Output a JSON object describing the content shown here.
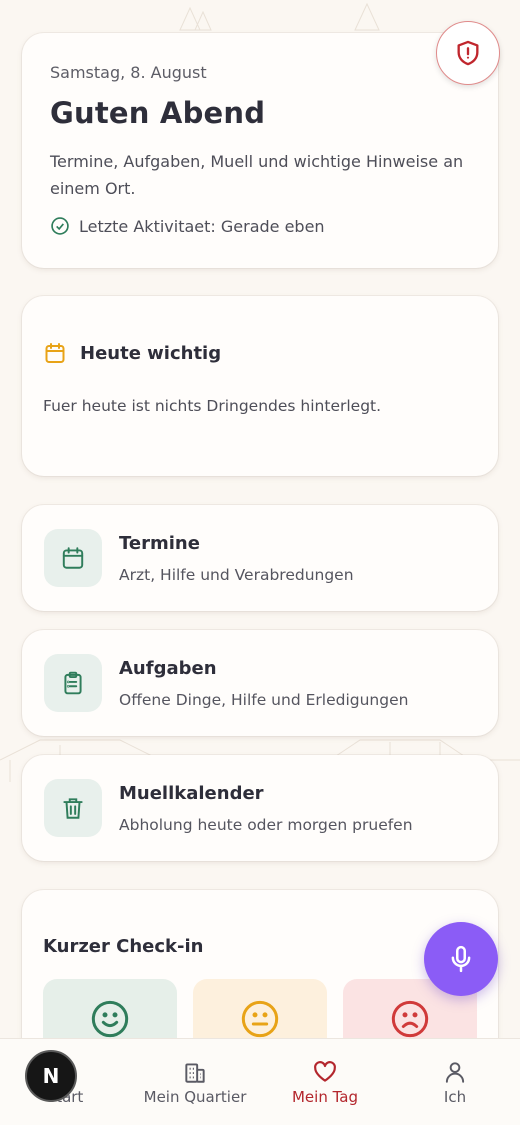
{
  "hero": {
    "date": "Samstag, 8. August",
    "greeting": "Guten Abend",
    "description": "Termine, Aufgaben, Muell und wichtige Hinweise an einem Ort.",
    "activity": "Letzte Aktivitaet: Gerade eben"
  },
  "important": {
    "title": "Heute wichtig",
    "body": "Fuer heute ist nichts Dringendes hinterlegt."
  },
  "cards": [
    {
      "title": "Termine",
      "subtitle": "Arzt, Hilfe und Verabredungen",
      "icon": "calendar-icon"
    },
    {
      "title": "Aufgaben",
      "subtitle": "Offene Dinge, Hilfe und Erledigungen",
      "icon": "clipboard-icon"
    },
    {
      "title": "Muellkalender",
      "subtitle": "Abholung heute oder morgen pruefen",
      "icon": "trash-icon"
    }
  ],
  "checkin": {
    "title": "Kurzer Check-in",
    "moods": [
      "happy-face-icon",
      "neutral-face-icon",
      "sad-face-icon"
    ]
  },
  "bottom_nav": {
    "items": [
      {
        "label": "Start",
        "icon": "home-icon"
      },
      {
        "label": "Mein Quartier",
        "icon": "building-icon"
      },
      {
        "label": "Mein Tag",
        "icon": "heart-icon",
        "active": true
      },
      {
        "label": "Ich",
        "icon": "user-icon"
      }
    ]
  },
  "overlay_badge": "N",
  "colors": {
    "accent_green": "#2f7d5b",
    "accent_red": "#b3262d",
    "mic_purple": "#8b5cf6",
    "calendar_orange": "#e8a317"
  }
}
